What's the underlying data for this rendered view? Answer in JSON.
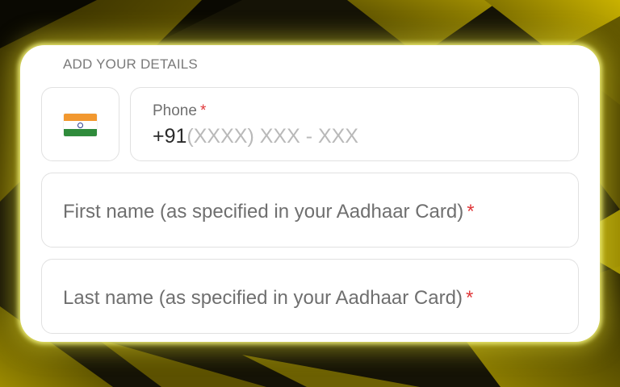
{
  "form": {
    "section_title": "ADD YOUR DETAILS",
    "country_flag": "india-flag-icon",
    "phone": {
      "label": "Phone",
      "required_mark": "*",
      "country_code": "+91",
      "placeholder": "(XXXX) XXX - XXX",
      "value": ""
    },
    "first_name": {
      "label": "First name (as specified in your Aadhaar Card)",
      "required_mark": "*",
      "value": ""
    },
    "last_name": {
      "label": "Last name (as specified in your Aadhaar Card)",
      "required_mark": "*",
      "value": ""
    }
  },
  "colors": {
    "accent_glow": "#e6d400",
    "required": "#e0383a",
    "label": "#6f6f6f",
    "placeholder": "#b9b9b9",
    "border": "#e1e1e1"
  }
}
